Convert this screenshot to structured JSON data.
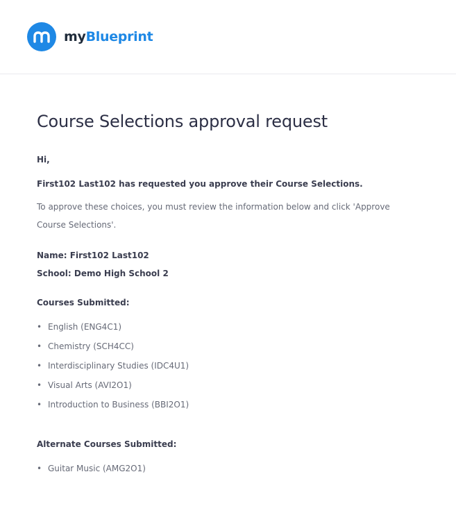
{
  "brand": {
    "logo_glyph": "m",
    "name_prefix": "my",
    "name_suffix": "Blueprint",
    "color": "#1e88e5"
  },
  "email": {
    "title": "Course Selections approval request",
    "greeting": "Hi,",
    "intro": "First102 Last102 has requested you approve their Course Selections.",
    "instructions": "To approve these choices, you must review the information below and click 'Approve Course Selections'.",
    "name_line": "Name: First102 Last102",
    "school_line": "School: Demo High School 2",
    "courses_heading": "Courses Submitted:",
    "courses": [
      "English (ENG4C1)",
      "Chemistry (SCH4CC)",
      "Interdisciplinary Studies (IDC4U1)",
      "Visual Arts (AVI2O1)",
      "Introduction to Business (BBI2O1)"
    ],
    "alternates_heading": "Alternate Courses Submitted:",
    "alternates": [
      "Guitar Music (AMG2O1)"
    ]
  }
}
